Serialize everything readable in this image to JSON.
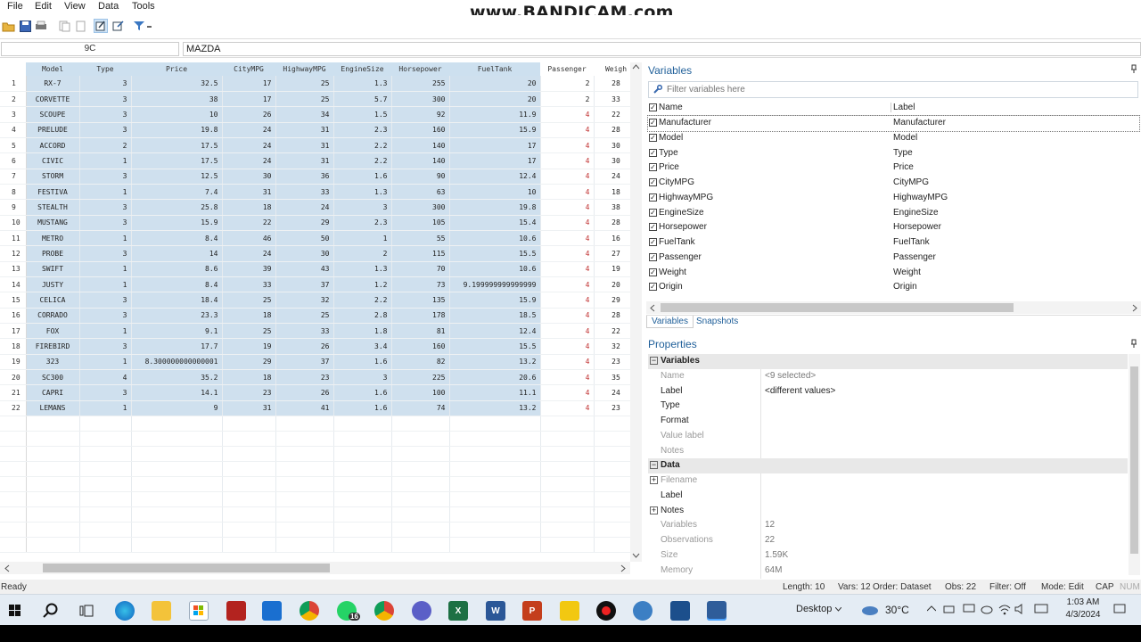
{
  "watermark": "www.BANDICAM.com",
  "menu": [
    "File",
    "Edit",
    "View",
    "Data",
    "Tools"
  ],
  "cmd": {
    "cell_ref": "9C",
    "cell_value": "MAZDA"
  },
  "grid": {
    "headers": [
      "Model",
      "Type",
      "Price",
      "CityMPG",
      "HighwayMPG",
      "EngineSize",
      "Horsepower",
      "FuelTank",
      "Passenger",
      "Weigh"
    ],
    "rows": [
      [
        "1",
        "RX-7",
        "3",
        "32.5",
        "17",
        "25",
        "1.3",
        "255",
        "20",
        "2",
        "28"
      ],
      [
        "2",
        "CORVETTE",
        "3",
        "38",
        "17",
        "25",
        "5.7",
        "300",
        "20",
        "2",
        "33"
      ],
      [
        "3",
        "SCOUPE",
        "3",
        "10",
        "26",
        "34",
        "1.5",
        "92",
        "11.9",
        "4",
        "22"
      ],
      [
        "4",
        "PRELUDE",
        "3",
        "19.8",
        "24",
        "31",
        "2.3",
        "160",
        "15.9",
        "4",
        "28"
      ],
      [
        "5",
        "ACCORD",
        "2",
        "17.5",
        "24",
        "31",
        "2.2",
        "140",
        "17",
        "4",
        "30"
      ],
      [
        "6",
        "CIVIC",
        "1",
        "17.5",
        "24",
        "31",
        "2.2",
        "140",
        "17",
        "4",
        "30"
      ],
      [
        "7",
        "STORM",
        "3",
        "12.5",
        "30",
        "36",
        "1.6",
        "90",
        "12.4",
        "4",
        "24"
      ],
      [
        "8",
        "FESTIVA",
        "1",
        "7.4",
        "31",
        "33",
        "1.3",
        "63",
        "10",
        "4",
        "18"
      ],
      [
        "9",
        "STEALTH",
        "3",
        "25.8",
        "18",
        "24",
        "3",
        "300",
        "19.8",
        "4",
        "38"
      ],
      [
        "10",
        "MUSTANG",
        "3",
        "15.9",
        "22",
        "29",
        "2.3",
        "105",
        "15.4",
        "4",
        "28"
      ],
      [
        "11",
        "METRO",
        "1",
        "8.4",
        "46",
        "50",
        "1",
        "55",
        "10.6",
        "4",
        "16"
      ],
      [
        "12",
        "PROBE",
        "3",
        "14",
        "24",
        "30",
        "2",
        "115",
        "15.5",
        "4",
        "27"
      ],
      [
        "13",
        "SWIFT",
        "1",
        "8.6",
        "39",
        "43",
        "1.3",
        "70",
        "10.6",
        "4",
        "19"
      ],
      [
        "14",
        "JUSTY",
        "1",
        "8.4",
        "33",
        "37",
        "1.2",
        "73",
        "9.199999999999999",
        "4",
        "20"
      ],
      [
        "15",
        "CELICA",
        "3",
        "18.4",
        "25",
        "32",
        "2.2",
        "135",
        "15.9",
        "4",
        "29"
      ],
      [
        "16",
        "CORRADO",
        "3",
        "23.3",
        "18",
        "25",
        "2.8",
        "178",
        "18.5",
        "4",
        "28"
      ],
      [
        "17",
        "FOX",
        "1",
        "9.1",
        "25",
        "33",
        "1.8",
        "81",
        "12.4",
        "4",
        "22"
      ],
      [
        "18",
        "FIREBIRD",
        "3",
        "17.7",
        "19",
        "26",
        "3.4",
        "160",
        "15.5",
        "4",
        "32"
      ],
      [
        "19",
        "323",
        "1",
        "8.300000000000001",
        "29",
        "37",
        "1.6",
        "82",
        "13.2",
        "4",
        "23"
      ],
      [
        "20",
        "SC300",
        "4",
        "35.2",
        "18",
        "23",
        "3",
        "225",
        "20.6",
        "4",
        "35"
      ],
      [
        "21",
        "CAPRI",
        "3",
        "14.1",
        "23",
        "26",
        "1.6",
        "100",
        "11.1",
        "4",
        "24"
      ],
      [
        "22",
        "LEMANS",
        "1",
        "9",
        "31",
        "41",
        "1.6",
        "74",
        "13.2",
        "4",
        "23"
      ]
    ]
  },
  "variables": {
    "title": "Variables",
    "filter_placeholder": "Filter variables here",
    "col_name": "Name",
    "col_label": "Label",
    "rows": [
      [
        "Manufacturer",
        "Manufacturer"
      ],
      [
        "Model",
        "Model"
      ],
      [
        "Type",
        "Type"
      ],
      [
        "Price",
        "Price"
      ],
      [
        "CityMPG",
        "CityMPG"
      ],
      [
        "HighwayMPG",
        "HighwayMPG"
      ],
      [
        "EngineSize",
        "EngineSize"
      ],
      [
        "Horsepower",
        "Horsepower"
      ],
      [
        "FuelTank",
        "FuelTank"
      ],
      [
        "Passenger",
        "Passenger"
      ],
      [
        "Weight",
        "Weight"
      ],
      [
        "Origin",
        "Origin"
      ]
    ],
    "tabs": [
      "Variables",
      "Snapshots"
    ]
  },
  "properties": {
    "title": "Properties",
    "sections": [
      {
        "type": "section",
        "label": "Variables"
      },
      {
        "type": "prop",
        "key": "Name",
        "value": "<9 selected>",
        "dim": true
      },
      {
        "type": "prop",
        "key": "Label",
        "value": "<different values>",
        "dim": false
      },
      {
        "type": "prop",
        "key": "Type",
        "value": "",
        "dim": false
      },
      {
        "type": "prop",
        "key": "Format",
        "value": "",
        "dim": false
      },
      {
        "type": "prop",
        "key": "Value label",
        "value": "",
        "dim": true
      },
      {
        "type": "prop",
        "key": "Notes",
        "value": "",
        "dim": true
      },
      {
        "type": "section",
        "label": "Data"
      },
      {
        "type": "prop",
        "key": "Filename",
        "value": "",
        "dim": true,
        "expand": true
      },
      {
        "type": "prop",
        "key": "Label",
        "value": "",
        "dim": false
      },
      {
        "type": "prop",
        "key": "Notes",
        "value": "",
        "dim": false,
        "expand": true
      },
      {
        "type": "prop",
        "key": "Variables",
        "value": "12",
        "dim": true
      },
      {
        "type": "prop",
        "key": "Observations",
        "value": "22",
        "dim": true
      },
      {
        "type": "prop",
        "key": "Size",
        "value": "1.59K",
        "dim": true
      },
      {
        "type": "prop",
        "key": "Memory",
        "value": "64M",
        "dim": true
      }
    ]
  },
  "status": {
    "left": "Ready",
    "length": "Length: 10",
    "vars": "Vars: 12",
    "order": "Order: Dataset",
    "obs": "Obs: 22",
    "filter": "Filter: Off",
    "mode": "Mode: Edit",
    "cap": "CAP",
    "num": "NUM"
  },
  "taskbar": {
    "desktop": "Desktop",
    "weather": "30°C",
    "time": "1:03 AM",
    "date": "4/3/2024",
    "whatsapp_badge": "16"
  }
}
